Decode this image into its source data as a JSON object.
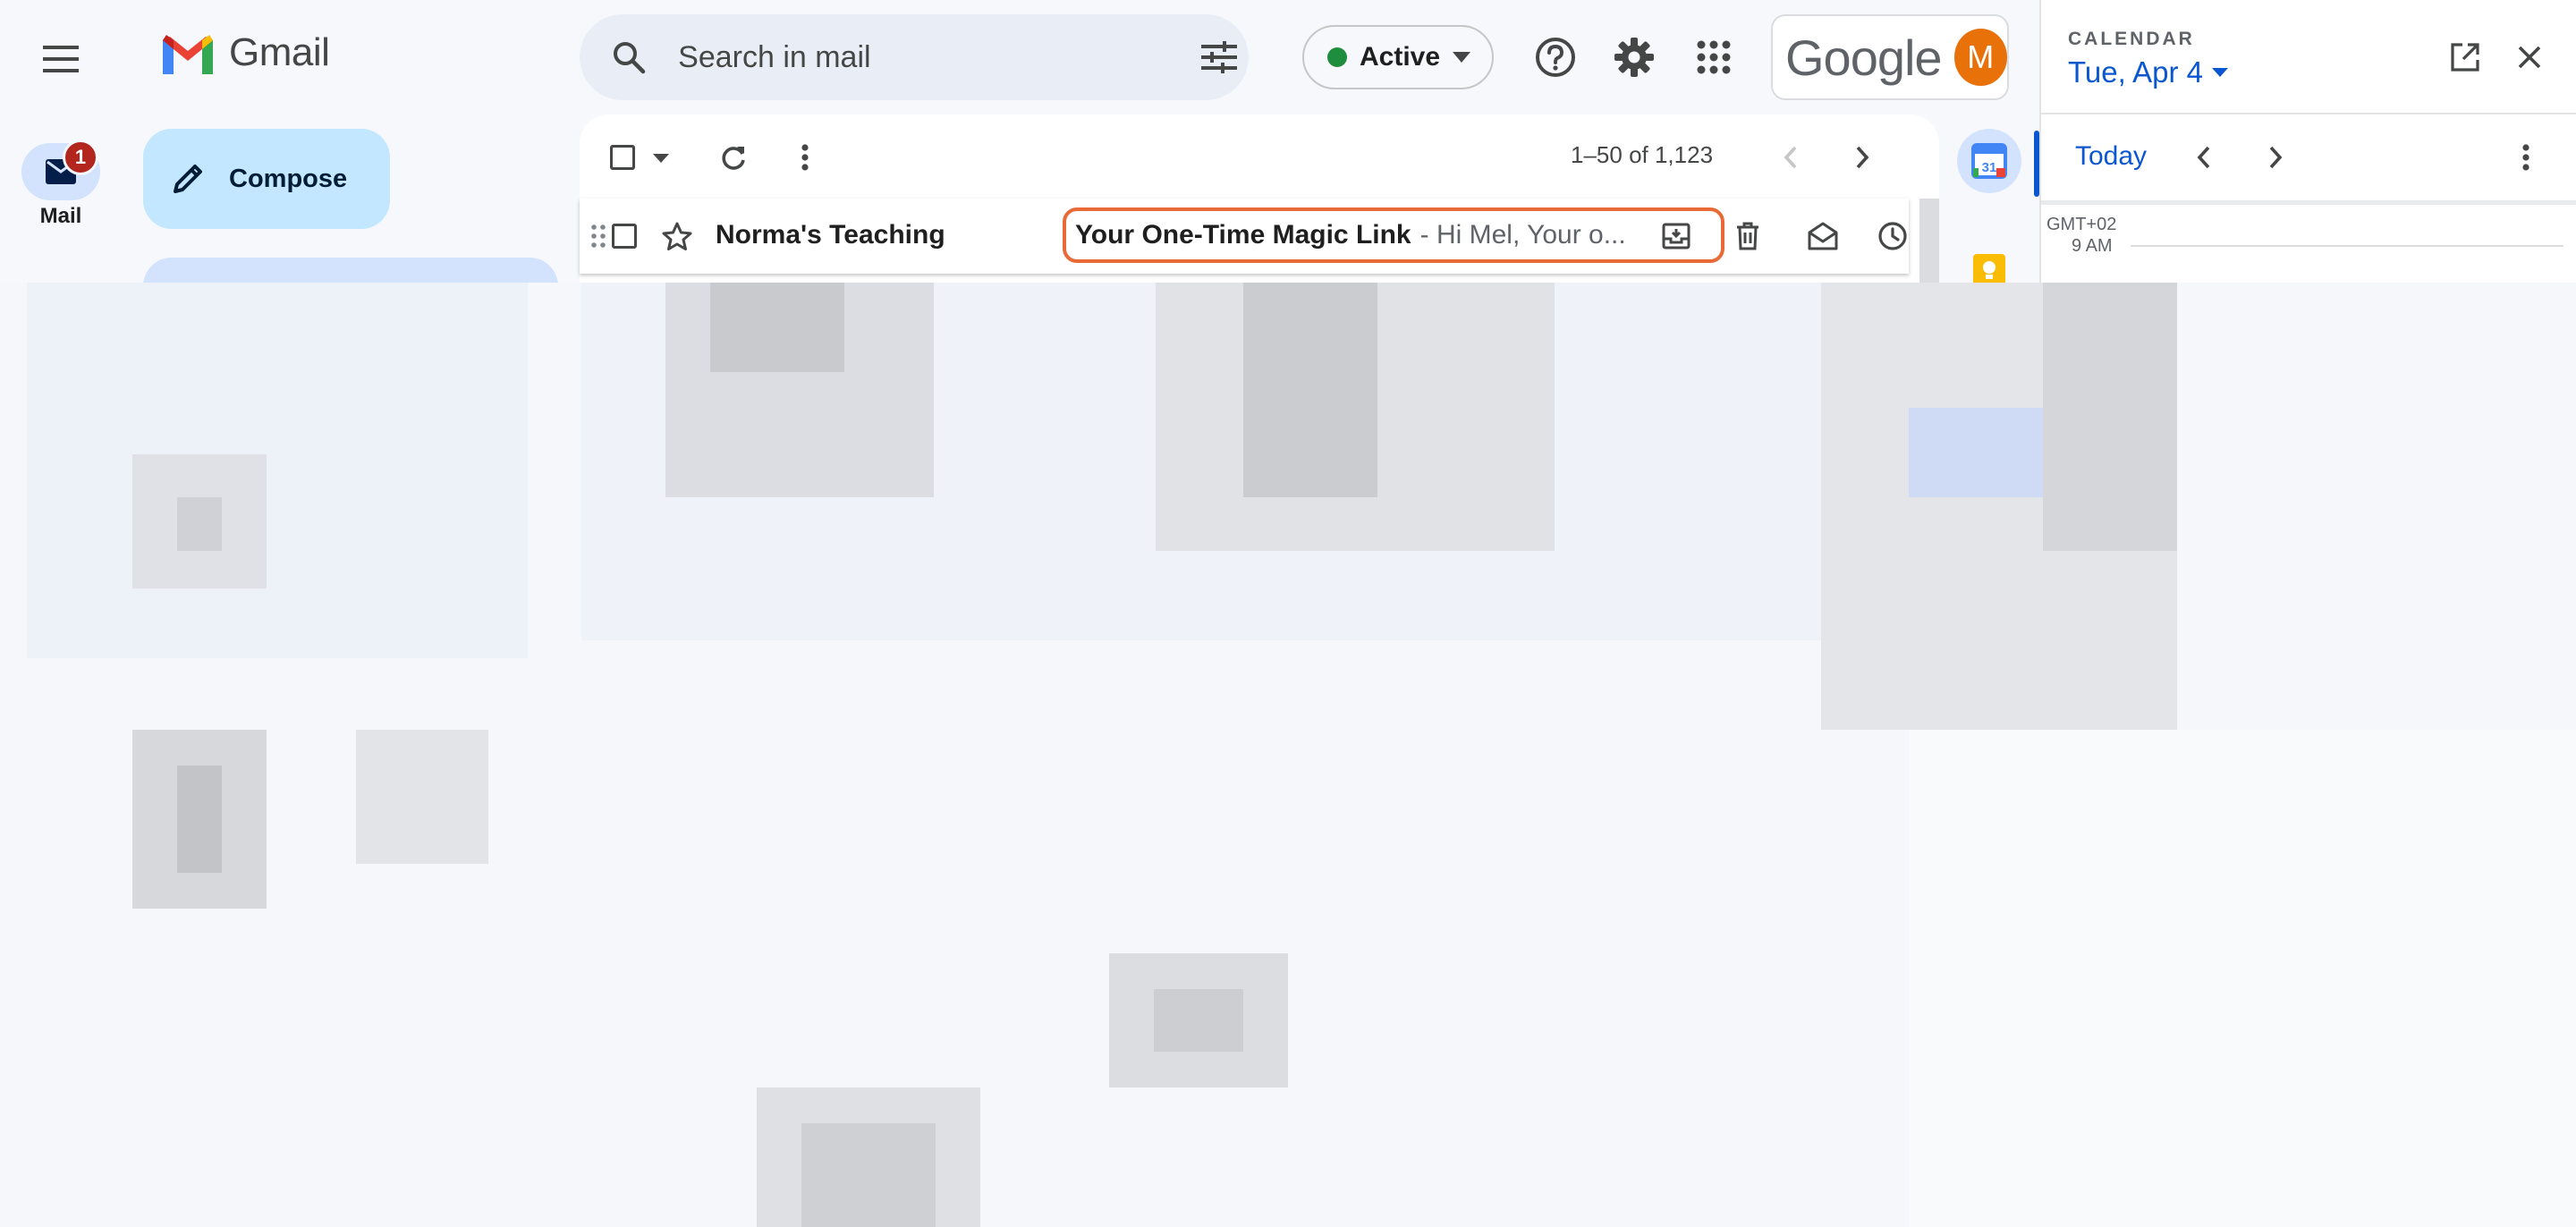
{
  "app": {
    "name": "Gmail",
    "brand_colors": {
      "accent": "#0b57d0",
      "compose": "#c2e7ff",
      "highlight": "#ea6a37",
      "badge": "#b3261e"
    }
  },
  "header": {
    "search_placeholder": "Search in mail",
    "status_label": "Active",
    "google_label": "Google",
    "avatar_initial": "M"
  },
  "rail": {
    "mail_label": "Mail",
    "mail_badge": "1"
  },
  "sidebar": {
    "compose_label": "Compose"
  },
  "toolbar": {
    "page_info": "1–50 of 1,123"
  },
  "email": {
    "sender": "Norma's Teaching",
    "subject": "Your One-Time Magic Link",
    "snippet": "- Hi Mel, Your o..."
  },
  "calendar": {
    "heading": "CALENDAR",
    "date": "Tue, Apr 4",
    "today_label": "Today",
    "timezone": "GMT+02",
    "first_hour": "9 AM",
    "icon_date": "31"
  },
  "icons": [
    "menu-icon",
    "gmail-logo-icon",
    "mail-icon",
    "pencil-icon",
    "search-icon",
    "filter-icon",
    "chevron-down-icon",
    "help-icon",
    "gear-icon",
    "apps-icon",
    "refresh-icon",
    "more-vert-icon",
    "chevron-left-icon",
    "chevron-right-icon",
    "drag-handle-icon",
    "star-icon",
    "archive-icon",
    "trash-icon",
    "mark-read-icon",
    "snooze-icon",
    "calendar-icon",
    "keep-icon",
    "open-new-icon",
    "close-icon"
  ]
}
